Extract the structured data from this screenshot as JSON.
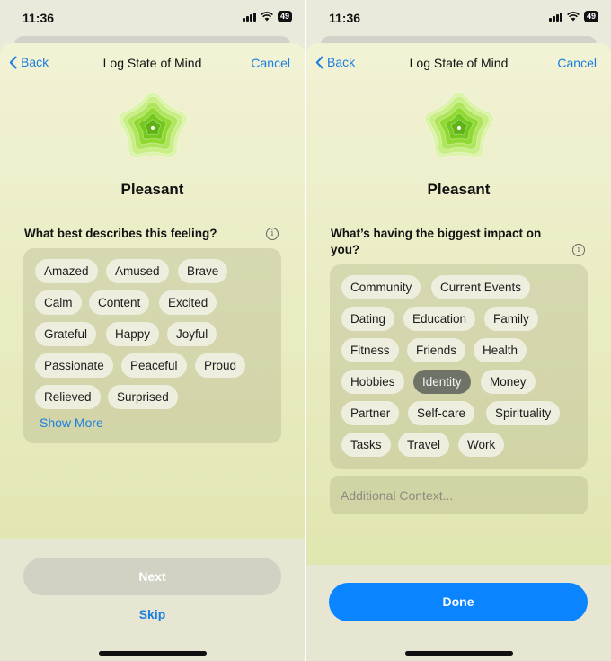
{
  "status_bar": {
    "time": "11:36",
    "battery": "49"
  },
  "left_screen": {
    "nav": {
      "back": "Back",
      "title": "Log State of Mind",
      "cancel": "Cancel"
    },
    "mood": "Pleasant",
    "question": "What best describes this feeling?",
    "chips": [
      "Amazed",
      "Amused",
      "Brave",
      "Calm",
      "Content",
      "Excited",
      "Grateful",
      "Happy",
      "Joyful",
      "Passionate",
      "Peaceful",
      "Proud",
      "Relieved",
      "Surprised"
    ],
    "show_more": "Show More",
    "next_button": "Next",
    "skip_link": "Skip"
  },
  "right_screen": {
    "nav": {
      "back": "Back",
      "title": "Log State of Mind",
      "cancel": "Cancel"
    },
    "mood": "Pleasant",
    "question": "What’s having the biggest impact on you?",
    "chips": [
      "Community",
      "Current Events",
      "Dating",
      "Education",
      "Family",
      "Fitness",
      "Friends",
      "Health",
      "Hobbies",
      "Identity",
      "Money",
      "Partner",
      "Self-care",
      "Spirituality",
      "Tasks",
      "Travel",
      "Work"
    ],
    "selected_chip": "Identity",
    "context_placeholder": "Additional Context...",
    "done_button": "Done"
  },
  "colors": {
    "accent": "#0b84ff",
    "link": "#1a7fe0",
    "flower": "#8fdc2a"
  }
}
